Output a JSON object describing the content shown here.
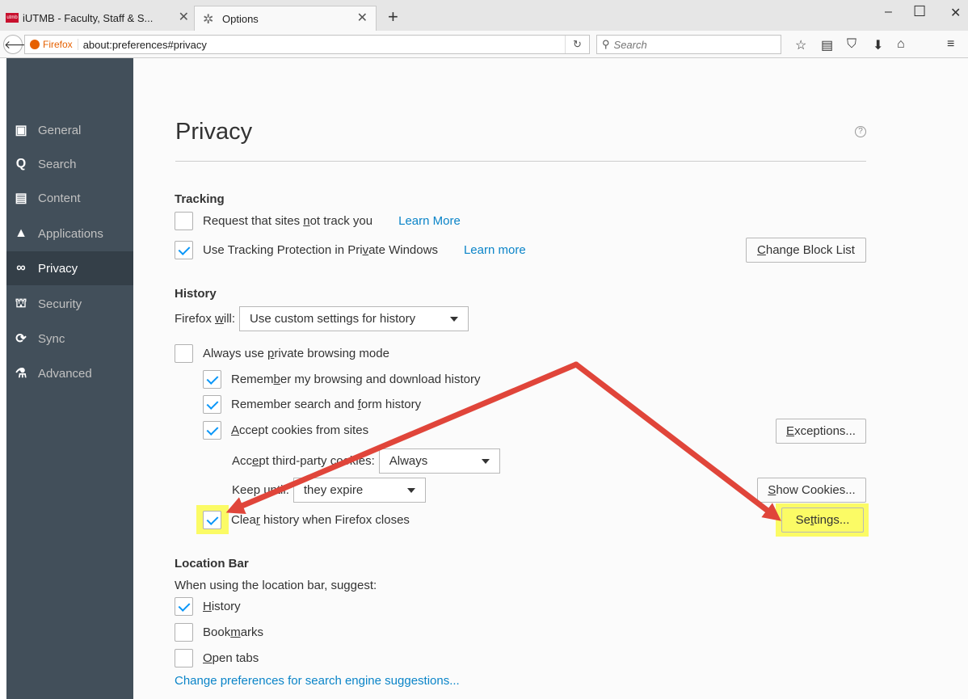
{
  "browser": {
    "tabs": [
      {
        "title": "iUTMB - Faculty, Staff & S...",
        "favicon": "utmb-logo"
      },
      {
        "title": "Options",
        "favicon": "gear-icon"
      }
    ],
    "url_identity": "Firefox",
    "url": "about:preferences#privacy",
    "search_placeholder": "Search"
  },
  "sidebar": {
    "items": [
      {
        "label": "General",
        "icon": "general-icon"
      },
      {
        "label": "Search",
        "icon": "search-icon"
      },
      {
        "label": "Content",
        "icon": "content-icon"
      },
      {
        "label": "Applications",
        "icon": "applications-icon"
      },
      {
        "label": "Privacy",
        "icon": "privacy-mask-icon",
        "selected": true
      },
      {
        "label": "Security",
        "icon": "security-icon"
      },
      {
        "label": "Sync",
        "icon": "sync-icon"
      },
      {
        "label": "Advanced",
        "icon": "advanced-icon"
      }
    ]
  },
  "page": {
    "title": "Privacy",
    "help": "?"
  },
  "tracking": {
    "heading": "Tracking",
    "dnt": {
      "pre": "Request that sites ",
      "u": "n",
      "post": "ot track you",
      "link": "Learn More",
      "checked": false
    },
    "tp": {
      "pre": "Use Tracking Protection in Pri",
      "u": "v",
      "post": "ate Windows",
      "link": "Learn more",
      "checked": true
    },
    "change_block_list": {
      "u": "C",
      "rest": "hange Block List"
    }
  },
  "history": {
    "heading": "History",
    "firefox_will": {
      "pre": "Firefox ",
      "u": "w",
      "post": "ill:"
    },
    "mode_value": "Use custom settings for history",
    "private_mode": {
      "pre": "Always use ",
      "u": "p",
      "post": "rivate browsing mode",
      "checked": false
    },
    "remember_browsing": {
      "pre": "Remem",
      "u": "b",
      "post": "er my browsing and download history",
      "checked": true
    },
    "remember_search": {
      "pre": "Remember search and ",
      "u": "f",
      "post": "orm history",
      "checked": true
    },
    "accept_cookies": {
      "pre": "",
      "u": "A",
      "post": "ccept cookies from sites",
      "checked": true
    },
    "exceptions": {
      "u": "E",
      "rest": "xceptions..."
    },
    "third_party": {
      "pre": "Acc",
      "u": "e",
      "post": "pt third-party cookies:",
      "value": "Always"
    },
    "keep_until": {
      "pre": "Keep ",
      "u": "u",
      "post": "ntil:",
      "value": "they expire"
    },
    "show_cookies": {
      "u": "S",
      "rest": "how Cookies..."
    },
    "clear_history": {
      "pre": "Clea",
      "u": "r",
      "post": " history when Firefox closes",
      "checked": true
    },
    "settings": {
      "pre": "Se",
      "u": "t",
      "post": "tings..."
    }
  },
  "location_bar": {
    "heading": "Location Bar",
    "intro": "When using the location bar, suggest:",
    "history": {
      "u": "H",
      "rest": "istory",
      "checked": true
    },
    "bookmarks": {
      "pre": "Book",
      "u": "m",
      "post": "arks",
      "checked": false
    },
    "open_tabs": {
      "u": "O",
      "rest": "pen tabs",
      "checked": false
    },
    "change_prefs_link": "Change preferences for search engine suggestions..."
  },
  "colors": {
    "sidebar_bg": "#424f5a",
    "sidebar_selected": "#343f48",
    "link": "#0a84c8",
    "checkmark": "#0996f8",
    "highlight": "#fbfb65",
    "annotation_arrow": "#e0453a"
  }
}
